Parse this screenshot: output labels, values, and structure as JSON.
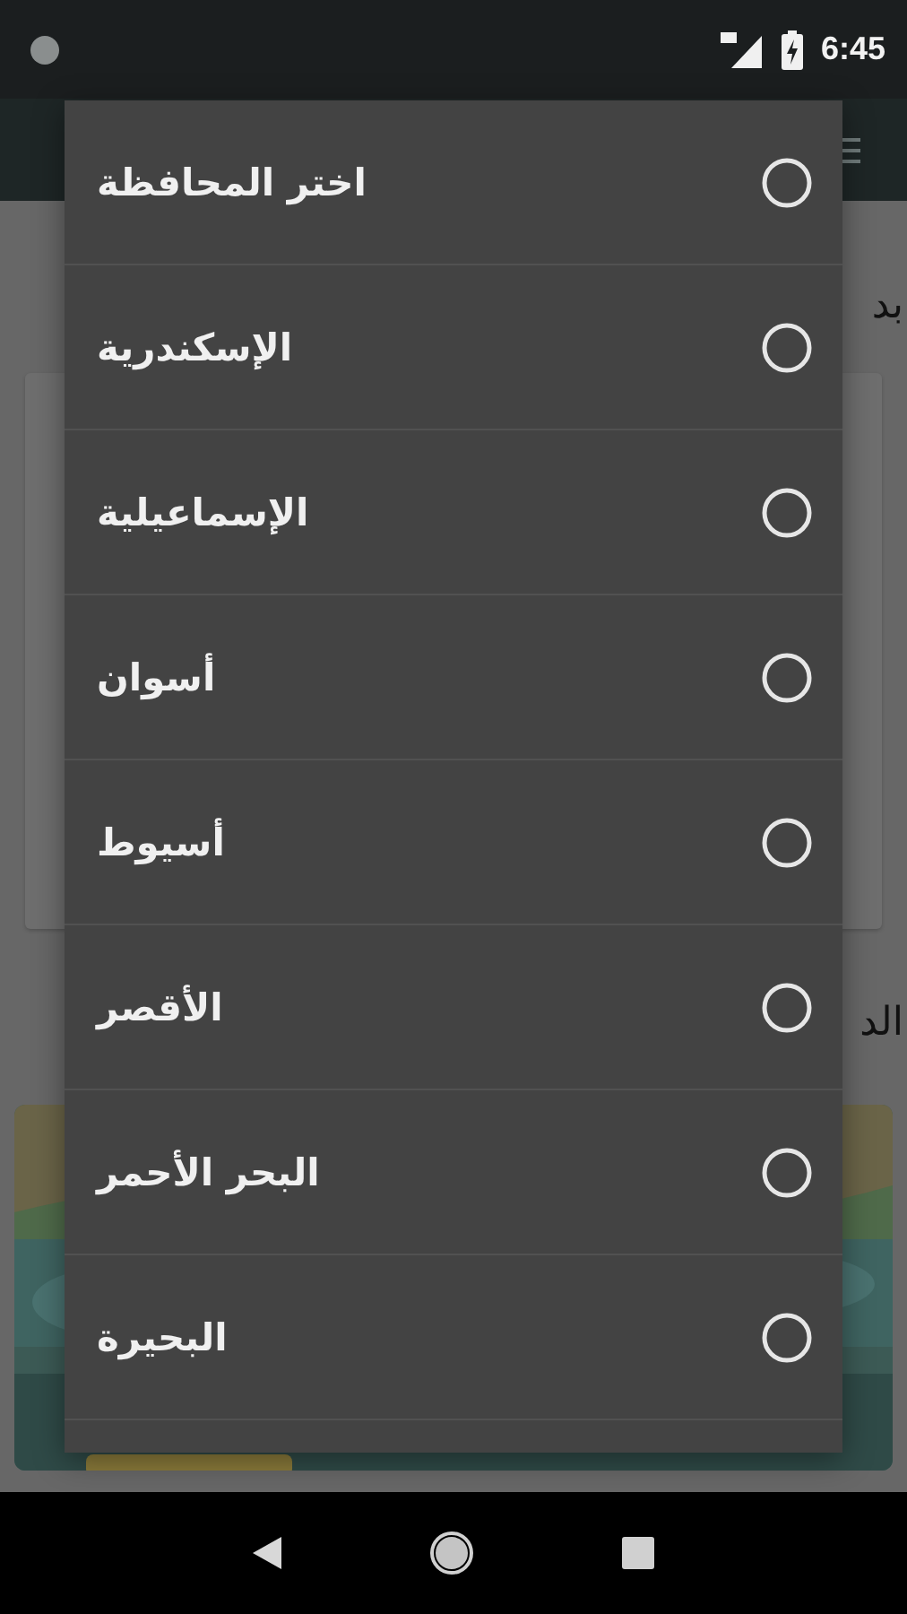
{
  "status_bar": {
    "time": "6:45"
  },
  "background": {
    "heading": "بد",
    "section_label": "الد"
  },
  "dialog": {
    "options": [
      {
        "label": "اختر المحافظة",
        "selected": false
      },
      {
        "label": "الإسكندرية",
        "selected": false
      },
      {
        "label": "الإسماعيلية",
        "selected": false
      },
      {
        "label": "أسوان",
        "selected": false
      },
      {
        "label": "أسيوط",
        "selected": false
      },
      {
        "label": "الأقصر",
        "selected": false
      },
      {
        "label": "البحر الأحمر",
        "selected": false
      },
      {
        "label": "البحيرة",
        "selected": false
      }
    ]
  }
}
